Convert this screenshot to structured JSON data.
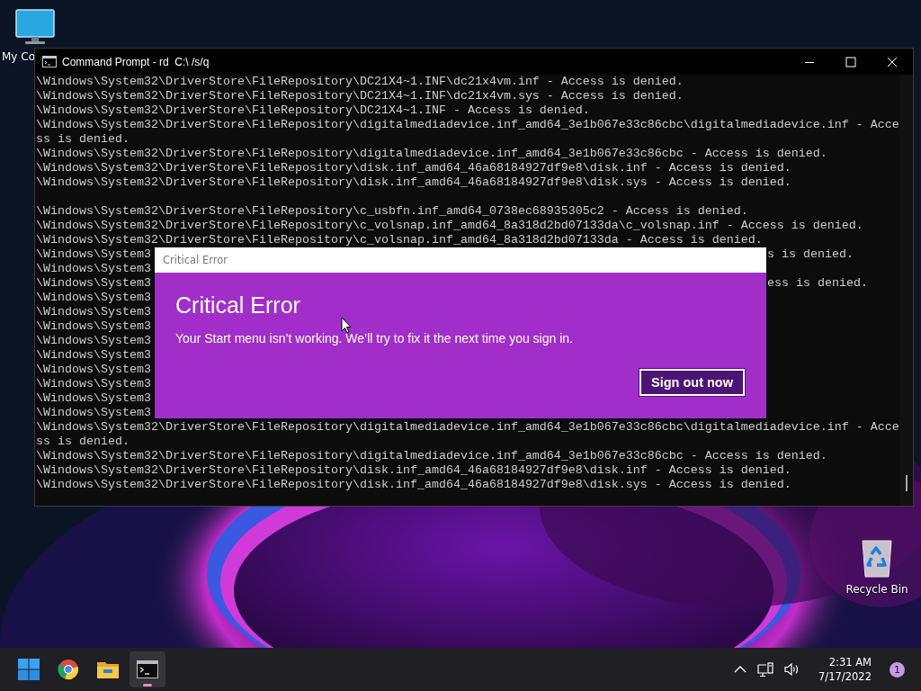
{
  "desktop_icons": [
    {
      "kind": "computer",
      "label": "My Co"
    },
    {
      "kind": "recycle-bin",
      "label": "Recycle Bin"
    }
  ],
  "console": {
    "title": "Command Prompt - rd  C:\\ /s/q",
    "lines": [
      {
        "kind": "text",
        "text": "\\Windows\\System32\\DriverStore\\FileRepository\\DC21X4~1.INF\\dc21x4vm.inf - Access is denied."
      },
      {
        "kind": "text",
        "text": "\\Windows\\System32\\DriverStore\\FileRepository\\DC21X4~1.INF\\dc21x4vm.sys - Access is denied."
      },
      {
        "kind": "text",
        "text": "\\Windows\\System32\\DriverStore\\FileRepository\\DC21X4~1.INF - Access is denied."
      },
      {
        "kind": "text",
        "text": "\\Windows\\System32\\DriverStore\\FileRepository\\digitalmediadevice.inf_amd64_3e1b067e33c86cbc\\digitalmediadevice.inf - Acce"
      },
      {
        "kind": "text",
        "text": "ss is denied."
      },
      {
        "kind": "text",
        "text": "\\Windows\\System32\\DriverStore\\FileRepository\\digitalmediadevice.inf_amd64_3e1b067e33c86cbc - Access is denied."
      },
      {
        "kind": "text",
        "text": "\\Windows\\System32\\DriverStore\\FileRepository\\disk.inf_amd64_46a68184927df9e8\\disk.inf - Access is denied."
      },
      {
        "kind": "text",
        "text": "\\Windows\\System32\\DriverStore\\FileRepository\\disk.inf_amd64_46a68184927df9e8\\disk.sys - Access is denied."
      },
      {
        "kind": "blank"
      },
      {
        "kind": "text",
        "text": "\\Windows\\System32\\DriverStore\\FileRepository\\c_usbfn.inf_amd64_0738ec68935305c2 - Access is denied."
      },
      {
        "kind": "text",
        "text": "\\Windows\\System32\\DriverStore\\FileRepository\\c_volsnap.inf_amd64_8a318d2bd07133da\\c_volsnap.inf - Access is denied."
      },
      {
        "kind": "text",
        "text": "\\Windows\\System32\\DriverStore\\FileRepository\\c_volsnap.inf_amd64_8a318d2bd07133da - Access is denied."
      },
      {
        "kind": "covered",
        "text": "\\Windows\\System3",
        "tail": "s is denied."
      },
      {
        "kind": "covered",
        "text": "\\Windows\\System3"
      },
      {
        "kind": "covered",
        "text": "\\Windows\\System3",
        "tail": "ess is denied."
      },
      {
        "kind": "covered",
        "text": "\\Windows\\System3"
      },
      {
        "kind": "covered",
        "text": "\\Windows\\System3"
      },
      {
        "kind": "covered",
        "text": "\\Windows\\System3"
      },
      {
        "kind": "covered",
        "text": "\\Windows\\System3"
      },
      {
        "kind": "covered",
        "text": "\\Windows\\System3"
      },
      {
        "kind": "covered",
        "text": "\\Windows\\System3"
      },
      {
        "kind": "covered",
        "text": "\\Windows\\System3"
      },
      {
        "kind": "covered",
        "text": "\\Windows\\System3"
      },
      {
        "kind": "covered",
        "text": "\\Windows\\System3"
      },
      {
        "kind": "text",
        "text": "\\Windows\\System32\\DriverStore\\FileRepository\\digitalmediadevice.inf_amd64_3e1b067e33c86cbc\\digitalmediadevice.inf - Acce"
      },
      {
        "kind": "text",
        "text": "ss is denied."
      },
      {
        "kind": "text",
        "text": "\\Windows\\System32\\DriverStore\\FileRepository\\digitalmediadevice.inf_amd64_3e1b067e33c86cbc - Access is denied."
      },
      {
        "kind": "text",
        "text": "\\Windows\\System32\\DriverStore\\FileRepository\\disk.inf_amd64_46a68184927df9e8\\disk.inf - Access is denied."
      },
      {
        "kind": "text",
        "text": "\\Windows\\System32\\DriverStore\\FileRepository\\disk.inf_amd64_46a68184927df9e8\\disk.sys - Access is denied."
      }
    ]
  },
  "dialog": {
    "caption": "Critical Error",
    "heading": "Critical Error",
    "message": "Your Start menu isn’t working. We’ll try to fix it the next time you sign in.",
    "button": "Sign out now"
  },
  "taskbar": {
    "apps": [
      {
        "kind": "start",
        "selected": false
      },
      {
        "kind": "browser",
        "selected": false
      },
      {
        "kind": "folder",
        "selected": false
      },
      {
        "kind": "terminal",
        "selected": true
      }
    ],
    "clock": {
      "time": "2:31 AM",
      "date": "7/17/2022"
    },
    "notifications": "1"
  }
}
